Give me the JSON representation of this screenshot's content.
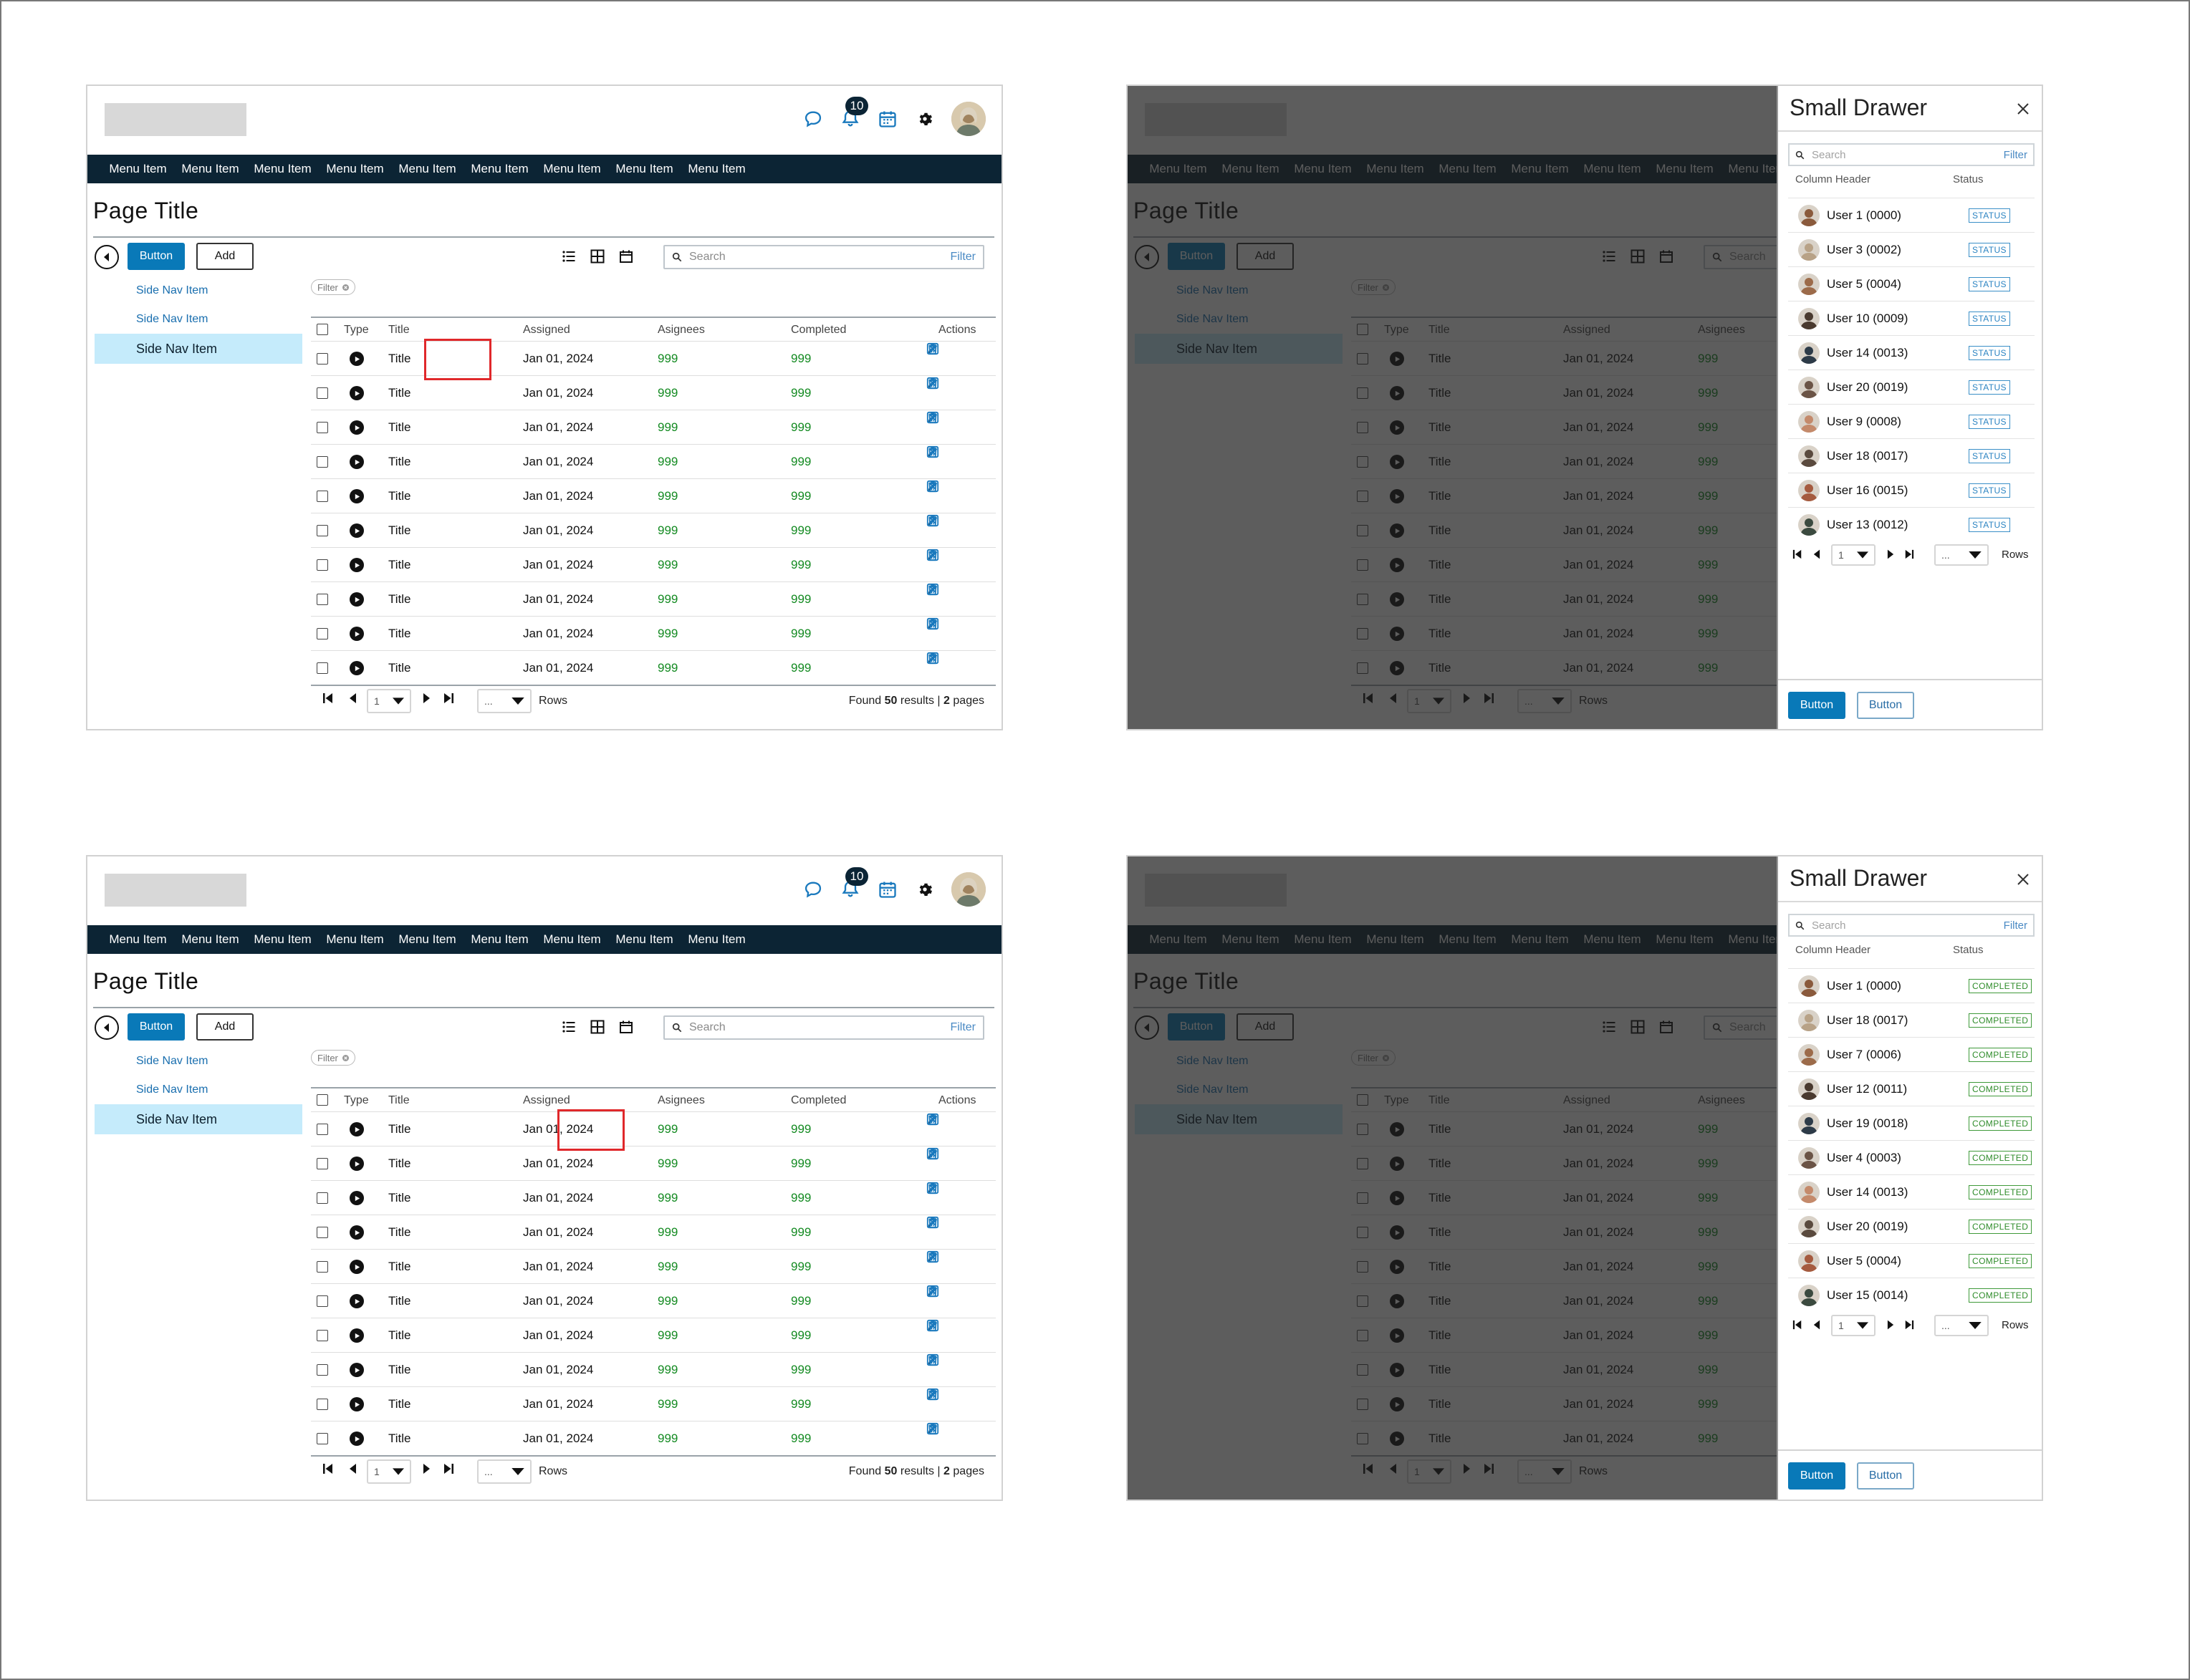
{
  "header": {
    "notification_count": "10"
  },
  "nav": {
    "items": [
      "Menu Item",
      "Menu Item",
      "Menu Item",
      "Menu Item",
      "Menu Item",
      "Menu Item",
      "Menu Item",
      "Menu Item",
      "Menu Item"
    ]
  },
  "page": {
    "title": "Page  Title"
  },
  "toolbar": {
    "primary_label": "Button",
    "add_label": "Add",
    "search_placeholder": "Search",
    "filter_label": "Filter"
  },
  "sidenav": {
    "items": [
      "Side Nav Item",
      "Side Nav Item",
      "Side Nav Item"
    ],
    "active_index": 2
  },
  "table": {
    "filter_chip": "Filter",
    "headers": {
      "type": "Type",
      "title": "Title",
      "assigned": "Assigned",
      "assignees": "Asignees",
      "completed": "Completed",
      "actions": "Actions"
    },
    "rows": [
      {
        "title": "Title",
        "assigned": "Jan 01, 2024",
        "assignees": "999",
        "completed": "999"
      },
      {
        "title": "Title",
        "assigned": "Jan 01, 2024",
        "assignees": "999",
        "completed": "999"
      },
      {
        "title": "Title",
        "assigned": "Jan 01, 2024",
        "assignees": "999",
        "completed": "999"
      },
      {
        "title": "Title",
        "assigned": "Jan 01, 2024",
        "assignees": "999",
        "completed": "999"
      },
      {
        "title": "Title",
        "assigned": "Jan 01, 2024",
        "assignees": "999",
        "completed": "999"
      },
      {
        "title": "Title",
        "assigned": "Jan 01, 2024",
        "assignees": "999",
        "completed": "999"
      },
      {
        "title": "Title",
        "assigned": "Jan 01, 2024",
        "assignees": "999",
        "completed": "999"
      },
      {
        "title": "Title",
        "assigned": "Jan 01, 2024",
        "assignees": "999",
        "completed": "999"
      },
      {
        "title": "Title",
        "assigned": "Jan 01, 2024",
        "assignees": "999",
        "completed": "999"
      },
      {
        "title": "Title",
        "assigned": "Jan 01, 2024",
        "assignees": "999",
        "completed": "999"
      }
    ],
    "pager": {
      "page": "1",
      "rows_value": "...",
      "rows_label": "Rows",
      "found_prefix": "Found",
      "found_count": "50",
      "found_mid": "results |",
      "pages_count": "2",
      "pages_suffix": "pages"
    }
  },
  "drawers": [
    {
      "title": "Small Drawer",
      "search_placeholder": "Search",
      "filter_label": "Filter",
      "col_header": "Column Header",
      "col_status": "Status",
      "users": [
        {
          "name": "User 1  (0000)",
          "status": "STATUS"
        },
        {
          "name": "User 3  (0002)",
          "status": "STATUS"
        },
        {
          "name": "User 5  (0004)",
          "status": "STATUS"
        },
        {
          "name": "User 10  (0009)",
          "status": "STATUS"
        },
        {
          "name": "User 14  (0013)",
          "status": "STATUS"
        },
        {
          "name": "User 20  (0019)",
          "status": "STATUS"
        },
        {
          "name": "User 9  (0008)",
          "status": "STATUS"
        },
        {
          "name": "User 18  (0017)",
          "status": "STATUS"
        },
        {
          "name": "User 16  (0015)",
          "status": "STATUS"
        },
        {
          "name": "User 13  (0012)",
          "status": "STATUS"
        }
      ],
      "pager": {
        "page": "1",
        "rows_value": "...",
        "rows_label": "Rows"
      },
      "footer": {
        "primary": "Button",
        "secondary": "Button"
      }
    },
    {
      "title": "Small Drawer",
      "search_placeholder": "Search",
      "filter_label": "Filter",
      "col_header": "Column Header",
      "col_status": "Status",
      "users": [
        {
          "name": "User 1  (0000)",
          "status": "COMPLETED"
        },
        {
          "name": "User 18  (0017)",
          "status": "COMPLETED"
        },
        {
          "name": "User 7  (0006)",
          "status": "COMPLETED"
        },
        {
          "name": "User 12  (0011)",
          "status": "COMPLETED"
        },
        {
          "name": "User 19  (0018)",
          "status": "COMPLETED"
        },
        {
          "name": "User 4  (0003)",
          "status": "COMPLETED"
        },
        {
          "name": "User 14  (0013)",
          "status": "COMPLETED"
        },
        {
          "name": "User 20  (0019)",
          "status": "COMPLETED"
        },
        {
          "name": "User 5  (0004)",
          "status": "COMPLETED"
        },
        {
          "name": "User 15  (0014)",
          "status": "COMPLETED"
        }
      ],
      "pager": {
        "page": "1",
        "rows_value": "...",
        "rows_label": "Rows"
      },
      "footer": {
        "primary": "Button",
        "secondary": "Button"
      }
    }
  ],
  "colors": {
    "nav_bg": "#0c2434",
    "primary": "#0979b8",
    "number_green": "#138a21",
    "highlight_red": "#e0282b",
    "active_nav_bg": "#c5ebfb"
  }
}
